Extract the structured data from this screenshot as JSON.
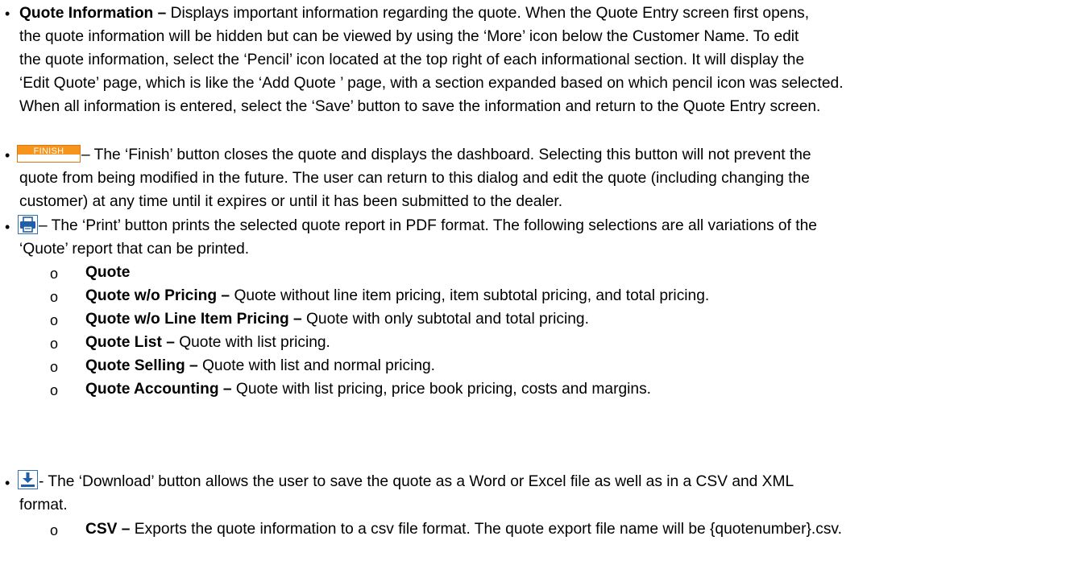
{
  "bullets": [
    {
      "title": "Quote Information",
      "dash": " – ",
      "lines": [
        "Displays important information regarding the quote.  When the Quote Entry screen first opens,",
        "the quote information will be hidden but can be viewed by using the ‘More’ icon below the Customer Name.  To edit",
        "the quote information, select the ‘Pencil’ icon located at the top right of each informational section.  It will display the",
        "‘Edit Quote’ page, which is like the ‘Add Quote ’ page, with a section expanded based on which pencil icon was selected.",
        "When all information is entered, select the ‘Save’ button to save the information and return to the Quote Entry screen."
      ]
    },
    {
      "button_label": "FINISH",
      "lines": [
        " – The ‘Finish’ button closes the quote and displays the dashboard.  Selecting this button will not prevent the",
        "quote from being modified in the future.  The user can return to this dialog and edit the quote (including changing the",
        "customer) at any time until it expires or until it has been submitted to the dealer."
      ]
    },
    {
      "icon": "print-icon",
      "lines": [
        " – The ‘Print’ button prints the selected quote report in PDF format.  The following selections are all variations of the",
        "‘Quote’ report that can be printed."
      ],
      "subitems": [
        {
          "title": "Quote",
          "text": ""
        },
        {
          "title": "Quote w/o Pricing –",
          "text": " Quote without line item pricing, item subtotal pricing, and total pricing."
        },
        {
          "title": "Quote w/o Line Item Pricing –",
          "text": " Quote with only subtotal and total pricing."
        },
        {
          "title": "Quote List –",
          "text": " Quote with list pricing."
        },
        {
          "title": "Quote Selling –",
          "text": " Quote with list and normal pricing."
        },
        {
          "title": "Quote Accounting –",
          "text": " Quote with list pricing, price book pricing, costs and margins."
        }
      ]
    },
    {
      "icon": "download-icon",
      "lines": [
        " - The ‘Download’ button allows the user to save the quote as a Word or Excel file as well as in a CSV and XML",
        "format."
      ],
      "subitems": [
        {
          "title": "CSV –",
          "text": " Exports the quote information to a csv file format.  The quote export file name will be {quotenumber}.csv."
        }
      ]
    }
  ],
  "marker": "•",
  "sub_marker": "o",
  "colors": {
    "finish_orange": "#f7941d",
    "icon_blue": "#2f6fb6"
  }
}
